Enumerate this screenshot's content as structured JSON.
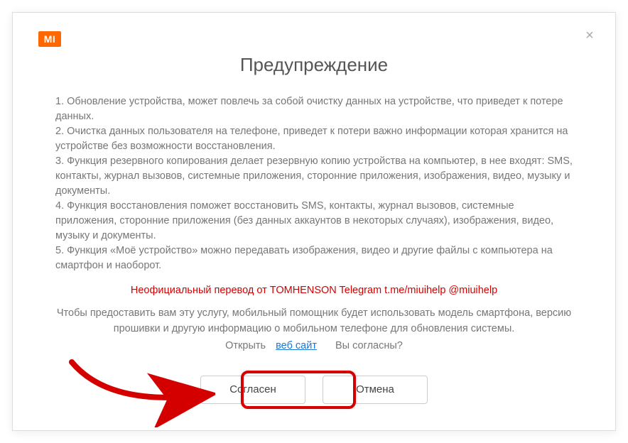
{
  "logo_text": "MI",
  "close_glyph": "×",
  "title": "Предупреждение",
  "body": {
    "p1": "1. Обновление устройства, может повлечь за собой очистку данных на устройстве, что приведет к потере данных.",
    "p2": "2. Очистка данных пользователя на телефоне, приведет к потери важно информации которая хранится на устройстве без возможности восстановления.",
    "p3": "3. Функция резервного копирования  делает резервную копию устройства на компьютер, в нее входят: SMS, контакты, журнал вызовов, системные приложения, сторонние приложения, изображения, видео, музыку и документы.",
    "p4": "4. Функция восстановления поможет восстановить SMS, контакты, журнал вызовов, системные приложения, сторонние приложения (без данных аккаунтов в некоторых случаях), изображения, видео, музыку и документы.",
    "p5": "5. Функция «Моё устройство» можно передавать изображения, видео и другие файлы с компьютера на смартфон и наоборот."
  },
  "translator_note": "Неофициальный перевод от TOMHENSON Telegram t.me/miuihelp @miuihelp",
  "consent_text": "Чтобы предоставить вам эту услугу, мобильный помощник будет использовать модель смартфона, версию прошивки и другую информацию о мобильном телефоне для обновления системы.",
  "open_label": "Открыть",
  "website_link": "веб сайт",
  "agree_question": "Вы согласны?",
  "buttons": {
    "agree": "Согласен",
    "cancel": "Отмена"
  }
}
